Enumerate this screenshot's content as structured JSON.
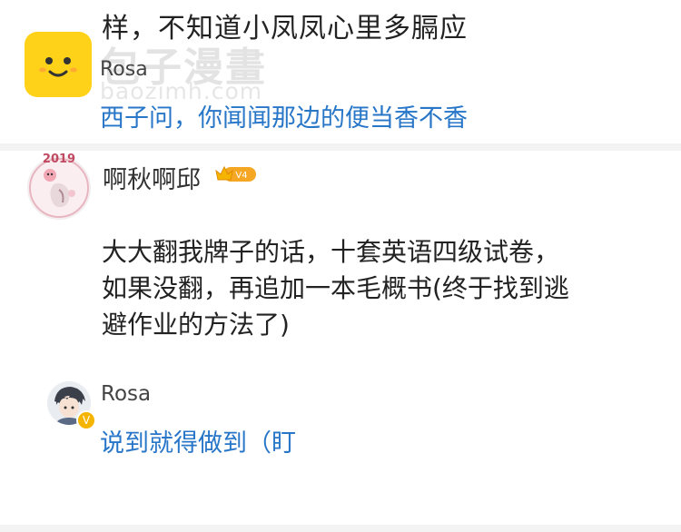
{
  "thread": {
    "truncated_text": "样，不知道小凤凤心里多膈应",
    "watermark_text": "包子漫畫",
    "watermark_url": "baozimh.com",
    "reply1": {
      "author": "Rosa",
      "text": "西子问，你闻闻那边的便当香不香"
    },
    "comment": {
      "author": "啊秋啊邱",
      "vip_level": "V4",
      "avatar_label": "2019",
      "lines": [
        "大大翻我牌子的话，十套英语四级试卷，",
        "如果没翻，再追加一本毛概书(终于找到逃",
        "避作业的方法了)"
      ]
    },
    "reply2": {
      "author": "Rosa",
      "verified_badge": "V",
      "text": "说到就得做到（盯"
    }
  },
  "colors": {
    "link": "#2876c8",
    "app_icon": "#ffd21a",
    "vip_badge": "#f5a623"
  }
}
